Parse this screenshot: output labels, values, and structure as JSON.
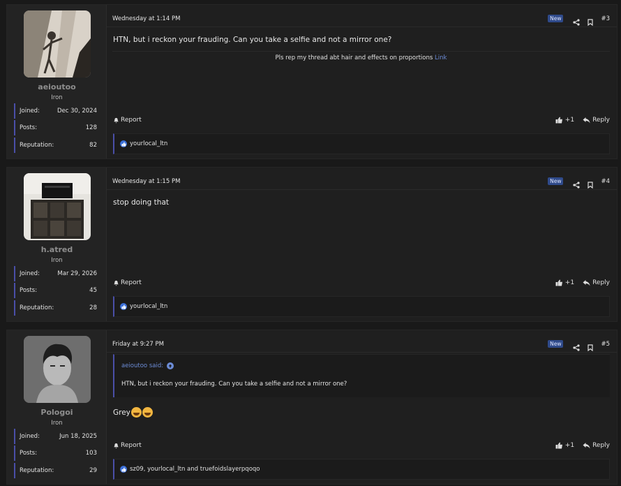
{
  "posts": [
    {
      "user": {
        "name": "aeioutoo",
        "title": "Iron",
        "joined_label": "Joined:",
        "joined": "Dec 30, 2024",
        "posts_label": "Posts:",
        "posts": "128",
        "rep_label": "Reputation:",
        "rep": "82"
      },
      "date": "Wednesday at 1:14 PM",
      "badge": "New",
      "number": "#3",
      "body": "HTN, but i reckon your frauding. Can you take a selfie and not a mirror one?",
      "signature": {
        "text": "Pls rep my thread abt hair and effects on proportions",
        "link": "Link"
      },
      "report": "Report",
      "like": "+1",
      "reply": "Reply",
      "reactions": "yourlocal_ltn"
    },
    {
      "user": {
        "name": "h.atred",
        "title": "Iron",
        "joined_label": "Joined:",
        "joined": "Mar 29, 2026",
        "posts_label": "Posts:",
        "posts": "45",
        "rep_label": "Reputation:",
        "rep": "28"
      },
      "date": "Wednesday at 1:15 PM",
      "badge": "New",
      "number": "#4",
      "body": "stop doing that",
      "report": "Report",
      "like": "+1",
      "reply": "Reply",
      "reactions": "yourlocal_ltn"
    },
    {
      "user": {
        "name": "Pologoi",
        "title": "Iron",
        "joined_label": "Joined:",
        "joined": "Jun 18, 2025",
        "posts_label": "Posts:",
        "posts": "103",
        "rep_label": "Reputation:",
        "rep": "29"
      },
      "date": "Friday at 9:27 PM",
      "badge": "New",
      "number": "#5",
      "quote": {
        "author": "aeioutoo said:",
        "text": "HTN, but i reckon your frauding. Can you take a selfie and not a mirror one?"
      },
      "body": "Grey",
      "report": "Report",
      "like": "+1",
      "reply": "Reply",
      "reactions": "sz09, yourlocal_ltn and truefoidslayerpqoqo"
    }
  ],
  "colors": {
    "accent": "#4a4fa8",
    "link": "#6c8cd6",
    "badge": "#2f4a8a",
    "like": "#3b6fd8"
  }
}
